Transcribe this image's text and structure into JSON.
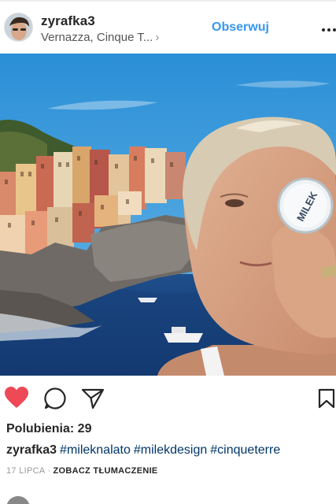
{
  "post": {
    "username": "zyrafka3",
    "location": "Vernazza, Cinque T...",
    "follow_label": "Obserwuj",
    "likes_text": "Polubienia: 29",
    "caption": {
      "username": "zyrafka3",
      "hashtags": [
        "#mileknalato",
        "#milekdesign",
        "#cinqueterre"
      ]
    },
    "date": "17 LIPCA",
    "separator": "·",
    "translate_label": "ZOBACZ TŁUMACZENIE",
    "photo_tin_text": "MILEK",
    "liked": true
  },
  "icons": {
    "header": [
      "avatar",
      "chevron-right-icon",
      "more-options-icon"
    ],
    "actions": [
      "heart-icon",
      "comment-icon",
      "share-icon",
      "bookmark-icon"
    ]
  },
  "colors": {
    "accent": "#3897f0",
    "liked_heart": "#ed4956",
    "hashtag": "#003569",
    "text": "#262626",
    "muted": "#999999"
  }
}
